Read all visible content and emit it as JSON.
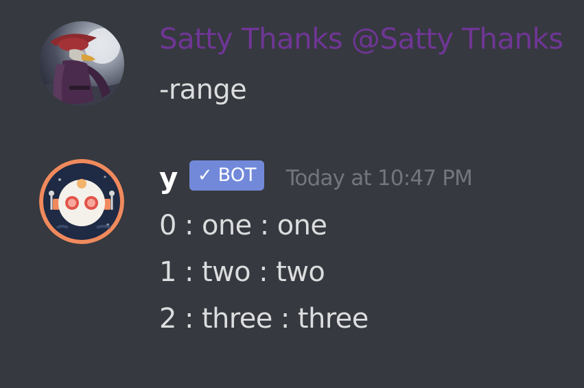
{
  "colors": {
    "background": "#36393f",
    "username_satty": "#6f3695",
    "bot_tag": "#7289da",
    "message_text": "#dcddde",
    "timestamp": "#72767d"
  },
  "messages": [
    {
      "author": "Satty Thanks @Satty Thanks",
      "avatar_icon": "caped-duck-hero-avatar",
      "lines": [
        "-range"
      ]
    },
    {
      "author": "y",
      "avatar_icon": "robot-face-avatar",
      "bot_tag": {
        "check_glyph": "✓",
        "label": "BOT"
      },
      "timestamp": "Today at 10:47 PM",
      "lines": [
        "0 : one : one",
        "1 : two : two",
        "2 : three : three"
      ]
    }
  ]
}
